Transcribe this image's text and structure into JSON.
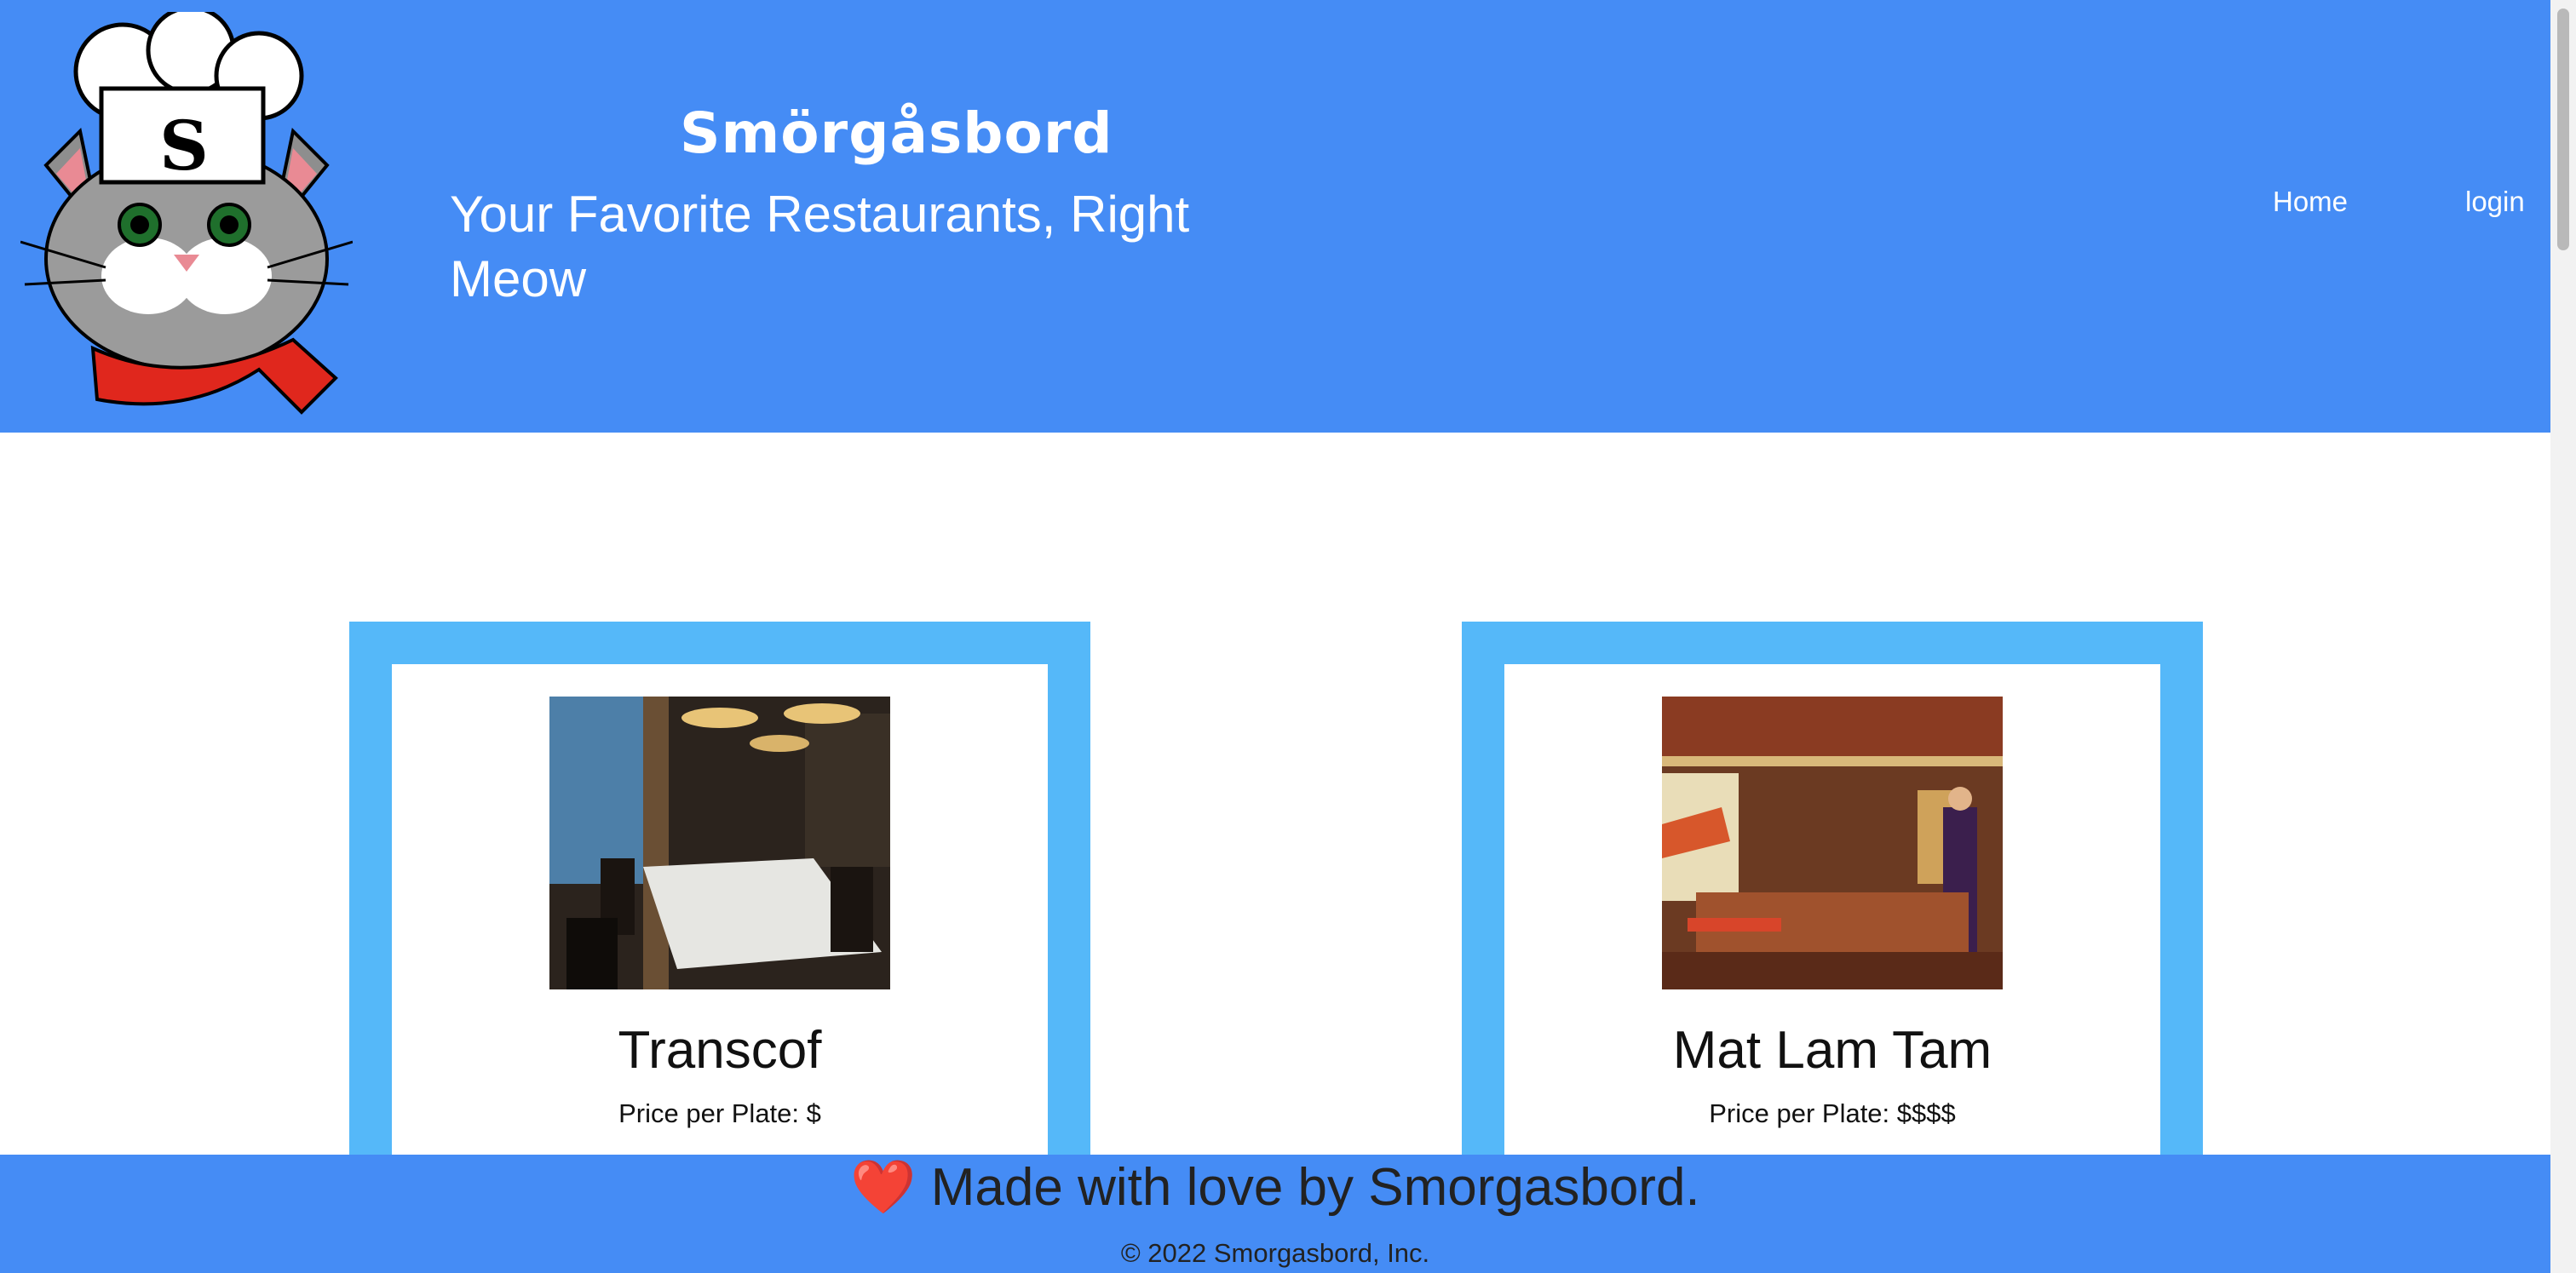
{
  "header": {
    "brand": "Smörgåsbord",
    "tagline": "Your Favorite Restaurants, Right Meow",
    "logo_letter": "S",
    "nav": [
      {
        "label": "Home"
      },
      {
        "label": "login"
      }
    ]
  },
  "restaurants": [
    {
      "name": "Transcof",
      "price": "Price per Plate: $"
    },
    {
      "name": "Mat Lam Tam",
      "price": "Price per Plate: $$$$"
    }
  ],
  "footer": {
    "heart_icon": "❤️",
    "love_text": "Made with love by Smorgasbord.",
    "copyright": "© 2022 Smorgasbord, Inc."
  },
  "colors": {
    "header_bg": "#458cf5",
    "card_border": "#55b8f9",
    "scarf": "#e0271d"
  }
}
